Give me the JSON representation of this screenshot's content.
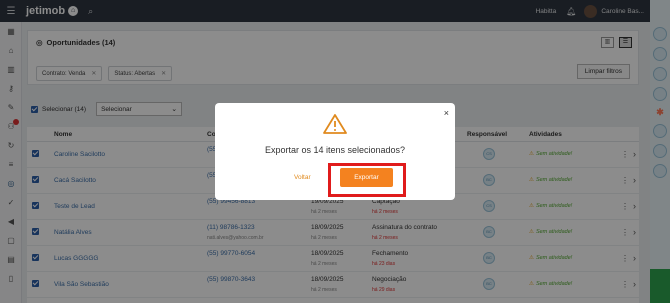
{
  "header": {
    "logo": "jetimob",
    "logo_badge": "⌂",
    "company": "Habitta",
    "user_name": "Caroline Bas..."
  },
  "panel": {
    "title": "Oportunidades (14)",
    "filters": [
      "Contrato: Venda",
      "Status: Abertas"
    ],
    "clear_label": "Limpar filtros"
  },
  "selection": {
    "label": "Selecionar (14)",
    "dropdown_value": "Selecionar"
  },
  "table": {
    "columns": [
      "Nome",
      "Co",
      "Responsável",
      "Atividades"
    ],
    "rows": [
      {
        "name": "Caroline Sacilotto",
        "phone": "(55)",
        "email": "",
        "date": "",
        "ago": "",
        "stage": "",
        "stage_ago": "",
        "resp": "CS",
        "activity": "Sem atividade!"
      },
      {
        "name": "Cacá Sacilotto",
        "phone": "(55)",
        "email": "",
        "date": "",
        "ago": "",
        "stage": "",
        "stage_ago": "",
        "resp": "BC",
        "activity": "Sem atividade!"
      },
      {
        "name": "Teste de Lead",
        "phone": "(55) 99456-8813",
        "email": "",
        "date": "19/09/2025",
        "ago": "há 2 meses",
        "stage": "Captação",
        "stage_ago": "há 2 meses",
        "resp": "CS",
        "activity": "Sem atividade!"
      },
      {
        "name": "Natália Alves",
        "phone": "(11) 98786-1323",
        "email": "nati.alves@yahoo.com.br",
        "date": "18/09/2025",
        "ago": "há 2 meses",
        "stage": "Assinatura do contrato",
        "stage_ago": "há 2 meses",
        "resp": "BC",
        "activity": "Sem atividade!"
      },
      {
        "name": "Lucas GGGGG",
        "phone": "(55) 99770-6054",
        "email": "",
        "date": "18/09/2025",
        "ago": "há 2 meses",
        "stage": "Fechamento",
        "stage_ago": "há 23 dias",
        "resp": "BC",
        "activity": "Sem atividade!"
      },
      {
        "name": "Vila São Sebastião",
        "phone": "(55) 99870-3643",
        "email": "",
        "date": "18/09/2025",
        "ago": "há 2 meses",
        "stage": "Negociação",
        "stage_ago": "há 29 dias",
        "resp": "BC",
        "activity": "Sem atividade!"
      }
    ]
  },
  "modal": {
    "message": "Exportar os 14 itens selecionados?",
    "back_label": "Voltar",
    "export_label": "Exportar",
    "close_glyph": "×"
  },
  "colors": {
    "accent": "#f4821f",
    "highlight": "#e01b1b",
    "topbar": "#2f3640",
    "link": "#3b6ea8"
  }
}
